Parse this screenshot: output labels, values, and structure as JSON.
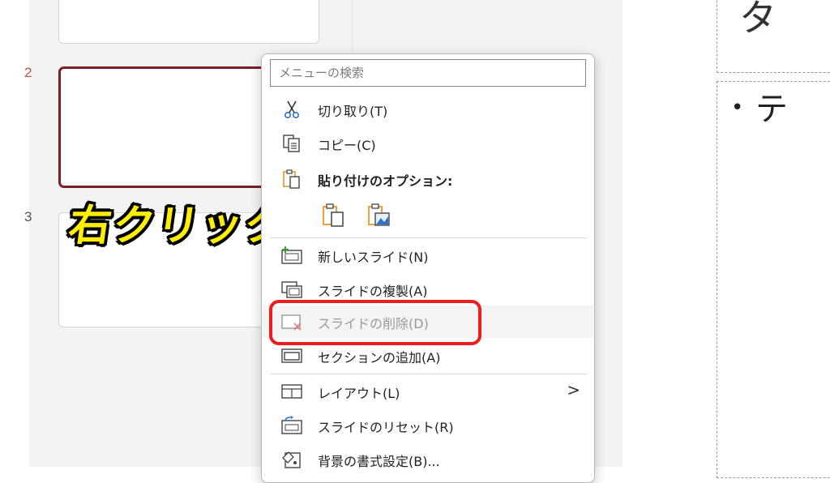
{
  "thumbnails": {
    "slide_numbers": [
      "2",
      "3"
    ]
  },
  "annotation": {
    "text": "右クリック",
    "color": "#ffee00"
  },
  "slide": {
    "title_text": "タ",
    "body_bullet": "•",
    "body_text": "テ"
  },
  "context_menu": {
    "search_placeholder": "メニューの検索",
    "items": {
      "cut": "切り取り(T)",
      "copy": "コピー(C)",
      "paste_options": "貼り付けのオプション:",
      "new_slide": "新しいスライド(N)",
      "duplicate_slide": "スライドの複製(A)",
      "delete_slide": "スライドの削除(D)",
      "add_section": "セクションの追加(A)",
      "layout": "レイアウト(L)",
      "reset_slide": "スライドのリセット(R)",
      "format_background": "背景の書式設定(B)..."
    },
    "submenu_arrow": ">",
    "paste_icons": [
      "paste-keep-source-formatting-icon",
      "paste-picture-icon"
    ],
    "highlight_color": "#ee1c1c",
    "icon_accent": "#e8a33d"
  }
}
